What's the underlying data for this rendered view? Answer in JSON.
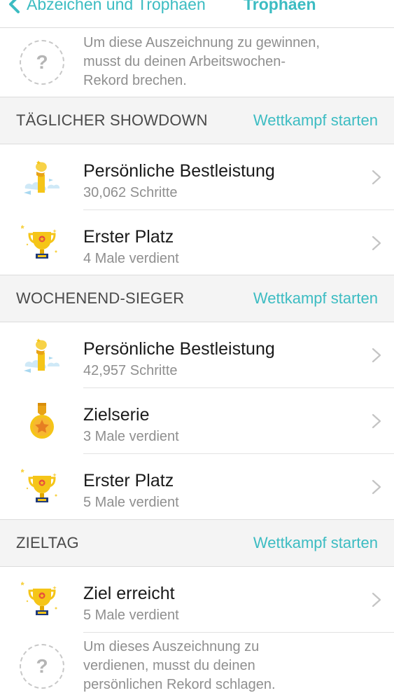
{
  "nav": {
    "back_label": "Abzeichen und Trophäen",
    "title": "Trophäen"
  },
  "top_locked": {
    "icon": "question-mark-icon",
    "line1": "Um diese Auszeichnung zu gewinnen,",
    "line2": "musst du deinen Arbeitswochen-",
    "line3": "Rekord brechen."
  },
  "sections": [
    {
      "title": "TÄGLICHER SHOWDOWN",
      "action": "Wettkampf starten",
      "rows": [
        {
          "icon": "personal-best-icon",
          "title": "Persönliche Bestleistung",
          "subtitle": "30,062 Schritte"
        },
        {
          "icon": "trophy-icon",
          "title": "Erster Platz",
          "subtitle": "4 Male verdient"
        }
      ]
    },
    {
      "title": "WOCHENEND-SIEGER",
      "action": "Wettkampf starten",
      "rows": [
        {
          "icon": "personal-best-icon",
          "title": "Persönliche Bestleistung",
          "subtitle": "42,957 Schritte"
        },
        {
          "icon": "medal-icon",
          "title": "Zielserie",
          "subtitle": "3 Male verdient"
        },
        {
          "icon": "trophy-icon",
          "title": "Erster Platz",
          "subtitle": "5 Male verdient"
        }
      ]
    },
    {
      "title": "ZIELTAG",
      "action": "Wettkampf starten",
      "rows": [
        {
          "icon": "trophy-icon",
          "title": "Ziel erreicht",
          "subtitle": "5 Male verdient"
        }
      ]
    }
  ],
  "bottom_locked": {
    "icon": "question-mark-icon",
    "line1": "Um dieses Auszeichnung zu",
    "line2": "verdienen, musst du deinen",
    "line3": "persönlichen Rekord schlagen."
  },
  "colors": {
    "accent": "#3cbcc2",
    "section_bg": "#f4f4f4",
    "gold": "#f5c518"
  }
}
